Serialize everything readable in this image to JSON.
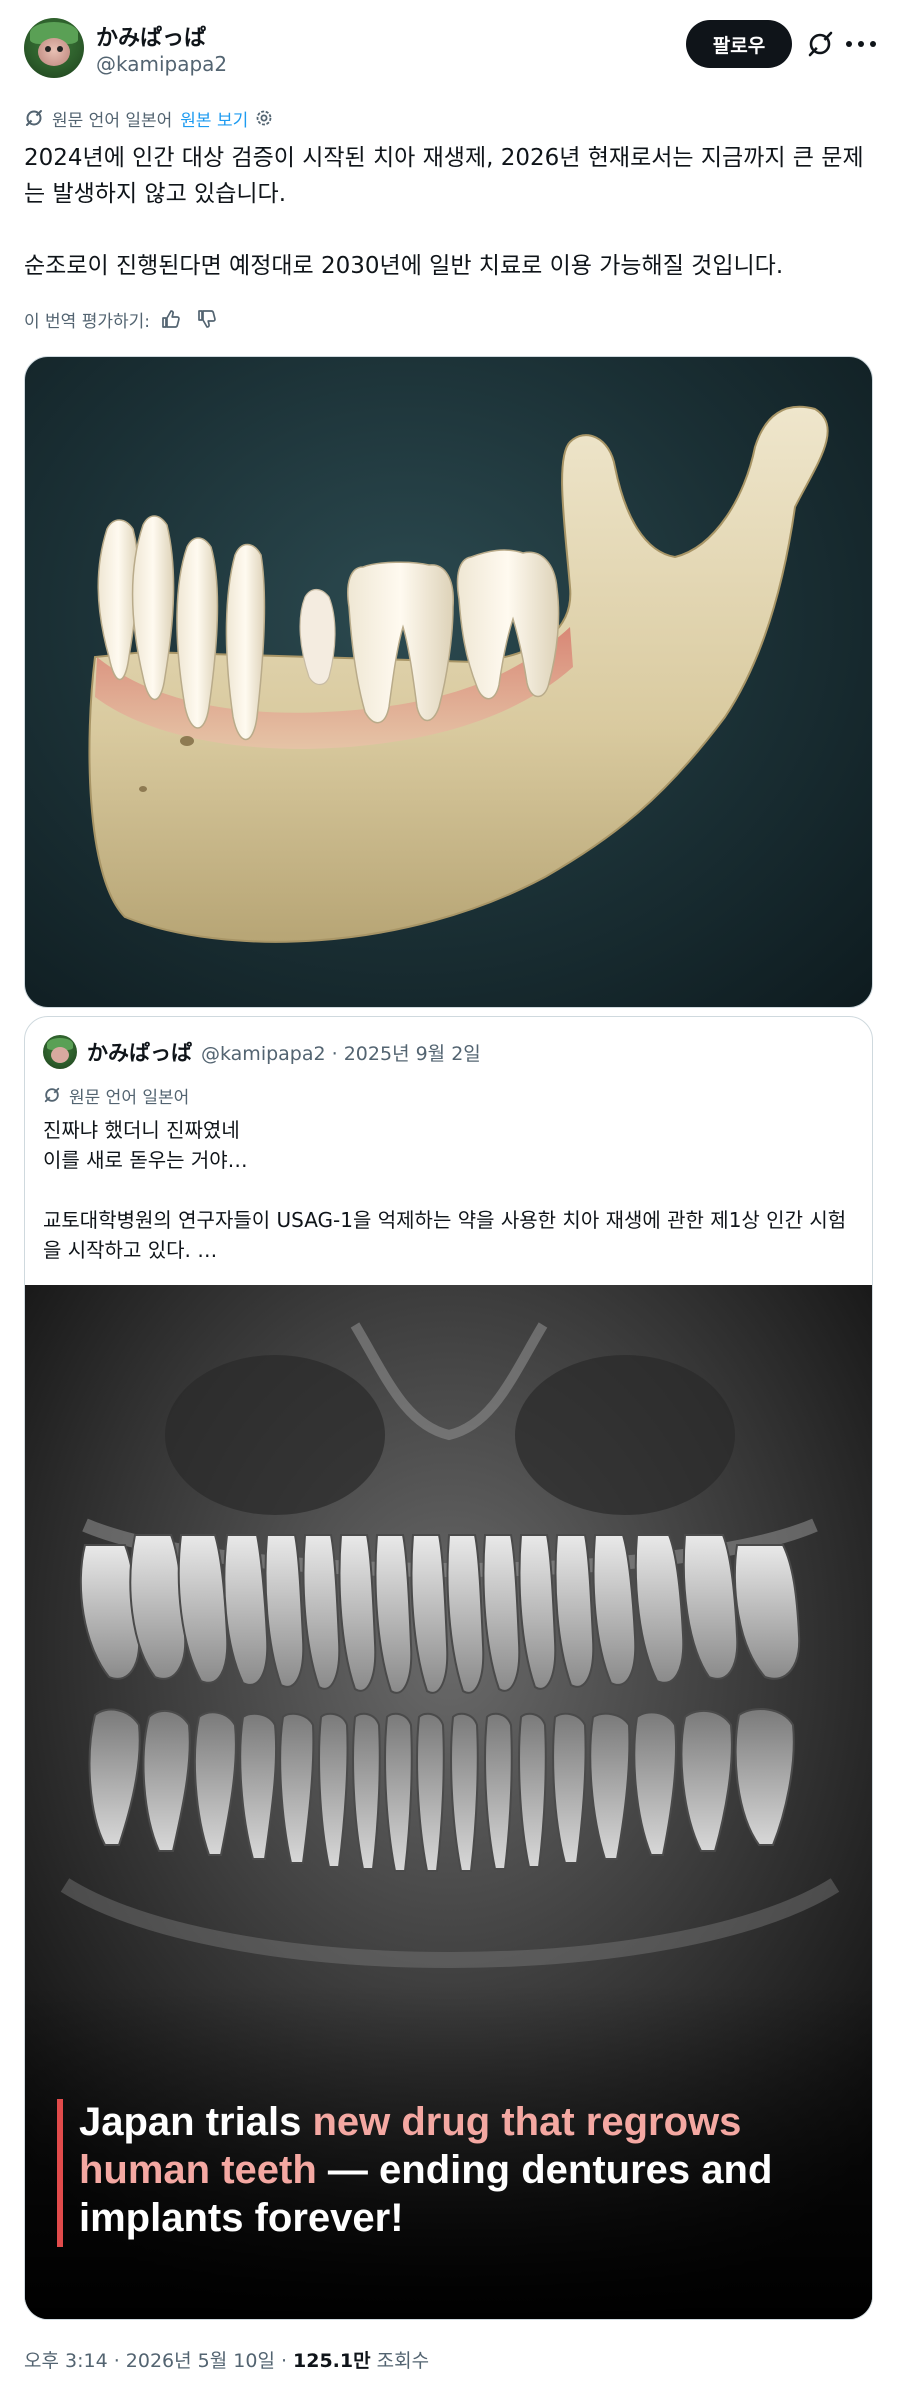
{
  "author": {
    "display_name": "かみぱっぱ",
    "handle": "@kamipapa2"
  },
  "header": {
    "follow_label": "팔로우",
    "icons": [
      "grok-icon",
      "more-icon"
    ]
  },
  "translation": {
    "source_label": "원문 언어 일본어",
    "view_original_label": "원본 보기"
  },
  "tweet": {
    "paragraph_1": "2024년에 인간 대상 검증이 시작된 치아 재생제, 2026년 현재로서는 지금까지 큰 문제는 발생하지 않고 있습니다.",
    "paragraph_2": "순조로이 진행된다면 예정대로 2030년에 일반 치료로 이용 가능해질 것입니다.",
    "rate_label": "이 번역 평가하기:"
  },
  "quote": {
    "display_name": "かみぱっぱ",
    "meta": "@kamipapa2 · 2025년 9월 2일",
    "translation_label": "원문 언어 일본어",
    "line_1": "진짜냐 했더니 진짜였네",
    "line_2": "이를 새로 돋우는 거야…",
    "line_3": "교토대학병원의 연구자들이 USAG-1을 억제하는 약을 사용한 치아 재생에 관한 제1상 인간 시험을 시작하고 있다.  …",
    "image_caption": {
      "line_1_plain": "Japan trials ",
      "line_1_highlight": "new drug that regrows",
      "line_2_highlight": "human teeth",
      "line_2_plain": " — ending dentures and",
      "line_3_plain": "implants forever!"
    }
  },
  "footer": {
    "time": "오후 3:14 · 2026년 5월 10일 · ",
    "views_count": "125.1만",
    "views_label": "조회수"
  },
  "colors": {
    "accent": "#1d9bf0",
    "text": "#0f1419",
    "secondary": "#536471",
    "caption_highlight": "#f4a8a2",
    "caption_bar": "#e14b4b"
  }
}
